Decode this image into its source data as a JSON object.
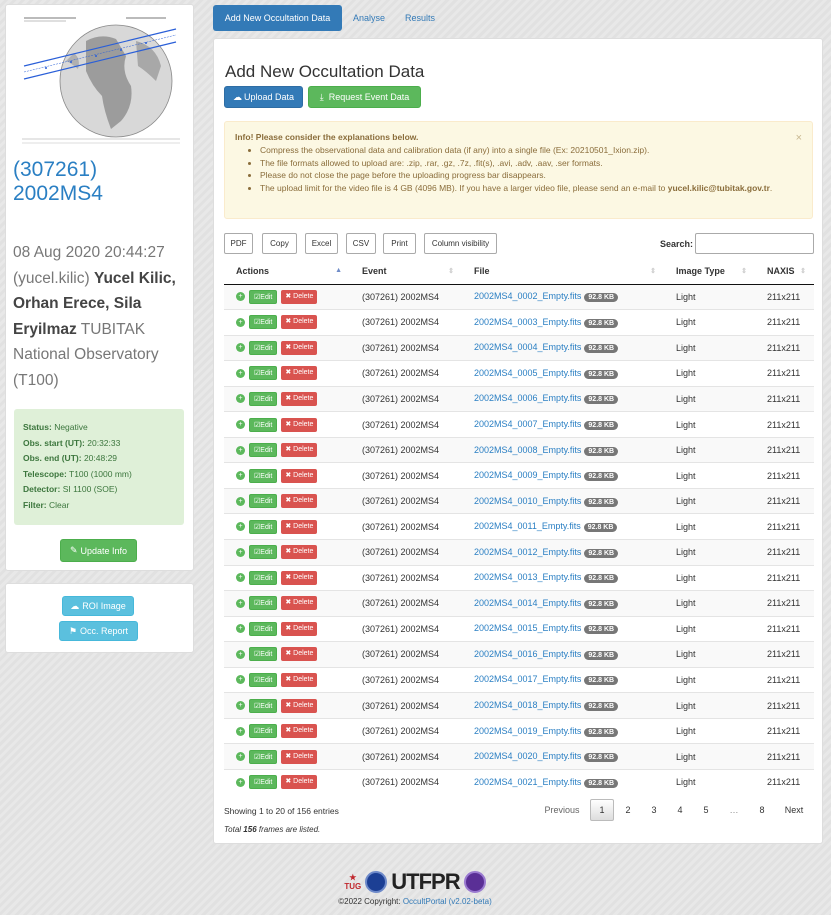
{
  "tabs": [
    "Add New Occultation Data",
    "Analyse",
    "Results"
  ],
  "sidebar": {
    "object_line1": "(307261)",
    "object_line2": "2002MS4",
    "date": "08 Aug 2020 20:44:27",
    "observers_intro": "(yucel.kilic)",
    "observers_bold": "Yucel Kilic, Orhan Erece, Sila Eryilmaz",
    "institution": "TUBITAK National Observatory (T100)",
    "status_label": "Status:",
    "status": "Negative",
    "obs_start_label": "Obs. start (UT):",
    "obs_start": "20:32:33",
    "obs_end_label": "Obs. end (UT):",
    "obs_end": "20:48:29",
    "telescope_label": "Telescope:",
    "telescope": "T100 (1000 mm)",
    "detector_label": "Detector:",
    "detector": "SI 1100 (SOE)",
    "filter_label": "Filter:",
    "filter": "Clear",
    "update_button": "Update Info",
    "roi_button": "ROI Image",
    "report_button": "Occ. Report"
  },
  "main": {
    "title": "Add New Occultation Data",
    "upload_button": "Upload Data",
    "request_button": "Request Event Data",
    "info_title": "Info! Please consider the explanations below.",
    "info_items": [
      "Compress the observational data and calibration data (if any) into a single file (Ex: 20210501_Ixion.zip).",
      "The file formats allowed to upload are: .zip, .rar, .gz, .7z, .fit(s), .avi, .adv, .aav, .ser formats.",
      "Please do not close the page before the uploading progress bar disappears.",
      "The upload limit for the video file is 4 GB (4096 MB). If you have a larger video file, please send an e-mail to"
    ],
    "info_email": "yucel.kilic@tubitak.gov.tr",
    "table_buttons": [
      "PDF",
      "Copy",
      "Excel",
      "CSV",
      "Print",
      "Column visibility"
    ],
    "search_label": "Search:",
    "columns": [
      "Actions",
      "Event",
      "File",
      "Image Type",
      "NAXIS"
    ],
    "edit_label": "Edit",
    "delete_label": "Delete",
    "event": "(307261) 2002MS4",
    "image_type": "Light",
    "naxis": "211x211",
    "size": "92.8 KB",
    "files": [
      "2002MS4_0002_Empty.fits",
      "2002MS4_0003_Empty.fits",
      "2002MS4_0004_Empty.fits",
      "2002MS4_0005_Empty.fits",
      "2002MS4_0006_Empty.fits",
      "2002MS4_0007_Empty.fits",
      "2002MS4_0008_Empty.fits",
      "2002MS4_0009_Empty.fits",
      "2002MS4_0010_Empty.fits",
      "2002MS4_0011_Empty.fits",
      "2002MS4_0012_Empty.fits",
      "2002MS4_0013_Empty.fits",
      "2002MS4_0014_Empty.fits",
      "2002MS4_0015_Empty.fits",
      "2002MS4_0016_Empty.fits",
      "2002MS4_0017_Empty.fits",
      "2002MS4_0018_Empty.fits",
      "2002MS4_0019_Empty.fits",
      "2002MS4_0020_Empty.fits",
      "2002MS4_0021_Empty.fits"
    ],
    "showing": "Showing 1 to 20 of 156 entries",
    "total_pre": "Total",
    "total_num": "156",
    "total_post": "frames are listed.",
    "pagination": [
      "Previous",
      "1",
      "2",
      "3",
      "4",
      "5",
      "…",
      "8",
      "Next"
    ]
  },
  "footer": {
    "copyright": "©2022 Copyright:",
    "link": "OccultPortal (v2.02-beta)",
    "logo_text": "UTFPR",
    "tug": "TUG"
  }
}
